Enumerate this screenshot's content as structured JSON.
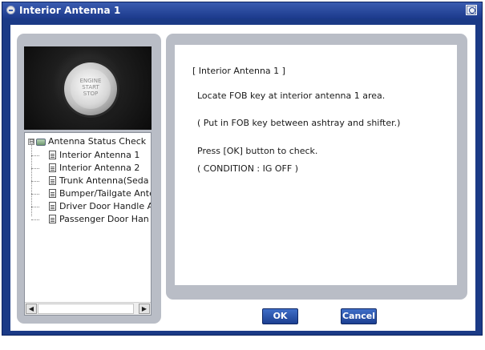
{
  "window": {
    "title": "Interior Antenna 1"
  },
  "image": {
    "caption_lines": [
      "ENGINE",
      "START",
      "STOP"
    ]
  },
  "tree": {
    "root_expander": "⊟",
    "root_label": "Antenna Status Check",
    "items": [
      {
        "label": "Interior Antenna 1"
      },
      {
        "label": "Interior Antenna 2"
      },
      {
        "label": "Trunk Antenna(Seda"
      },
      {
        "label": "Bumper/Tailgate Ante"
      },
      {
        "label": "Driver Door Handle A"
      },
      {
        "label": "Passenger Door Han"
      }
    ],
    "scroll_left": "◀",
    "scroll_right": "▶"
  },
  "message": {
    "lines": [
      "[ Interior Antenna 1 ]",
      "Locate FOB key at interior antenna 1 area.",
      "( Put in FOB key between ashtray and shifter.)",
      "Press [OK] button to check.",
      "( CONDITION : IG OFF )"
    ]
  },
  "buttons": {
    "ok_label": "OK",
    "cancel_label": "Cancel"
  },
  "colors": {
    "title_bar": "#1c3a8c",
    "panel_gray": "#b9bdc6",
    "button_blue": "#2a55b0"
  }
}
